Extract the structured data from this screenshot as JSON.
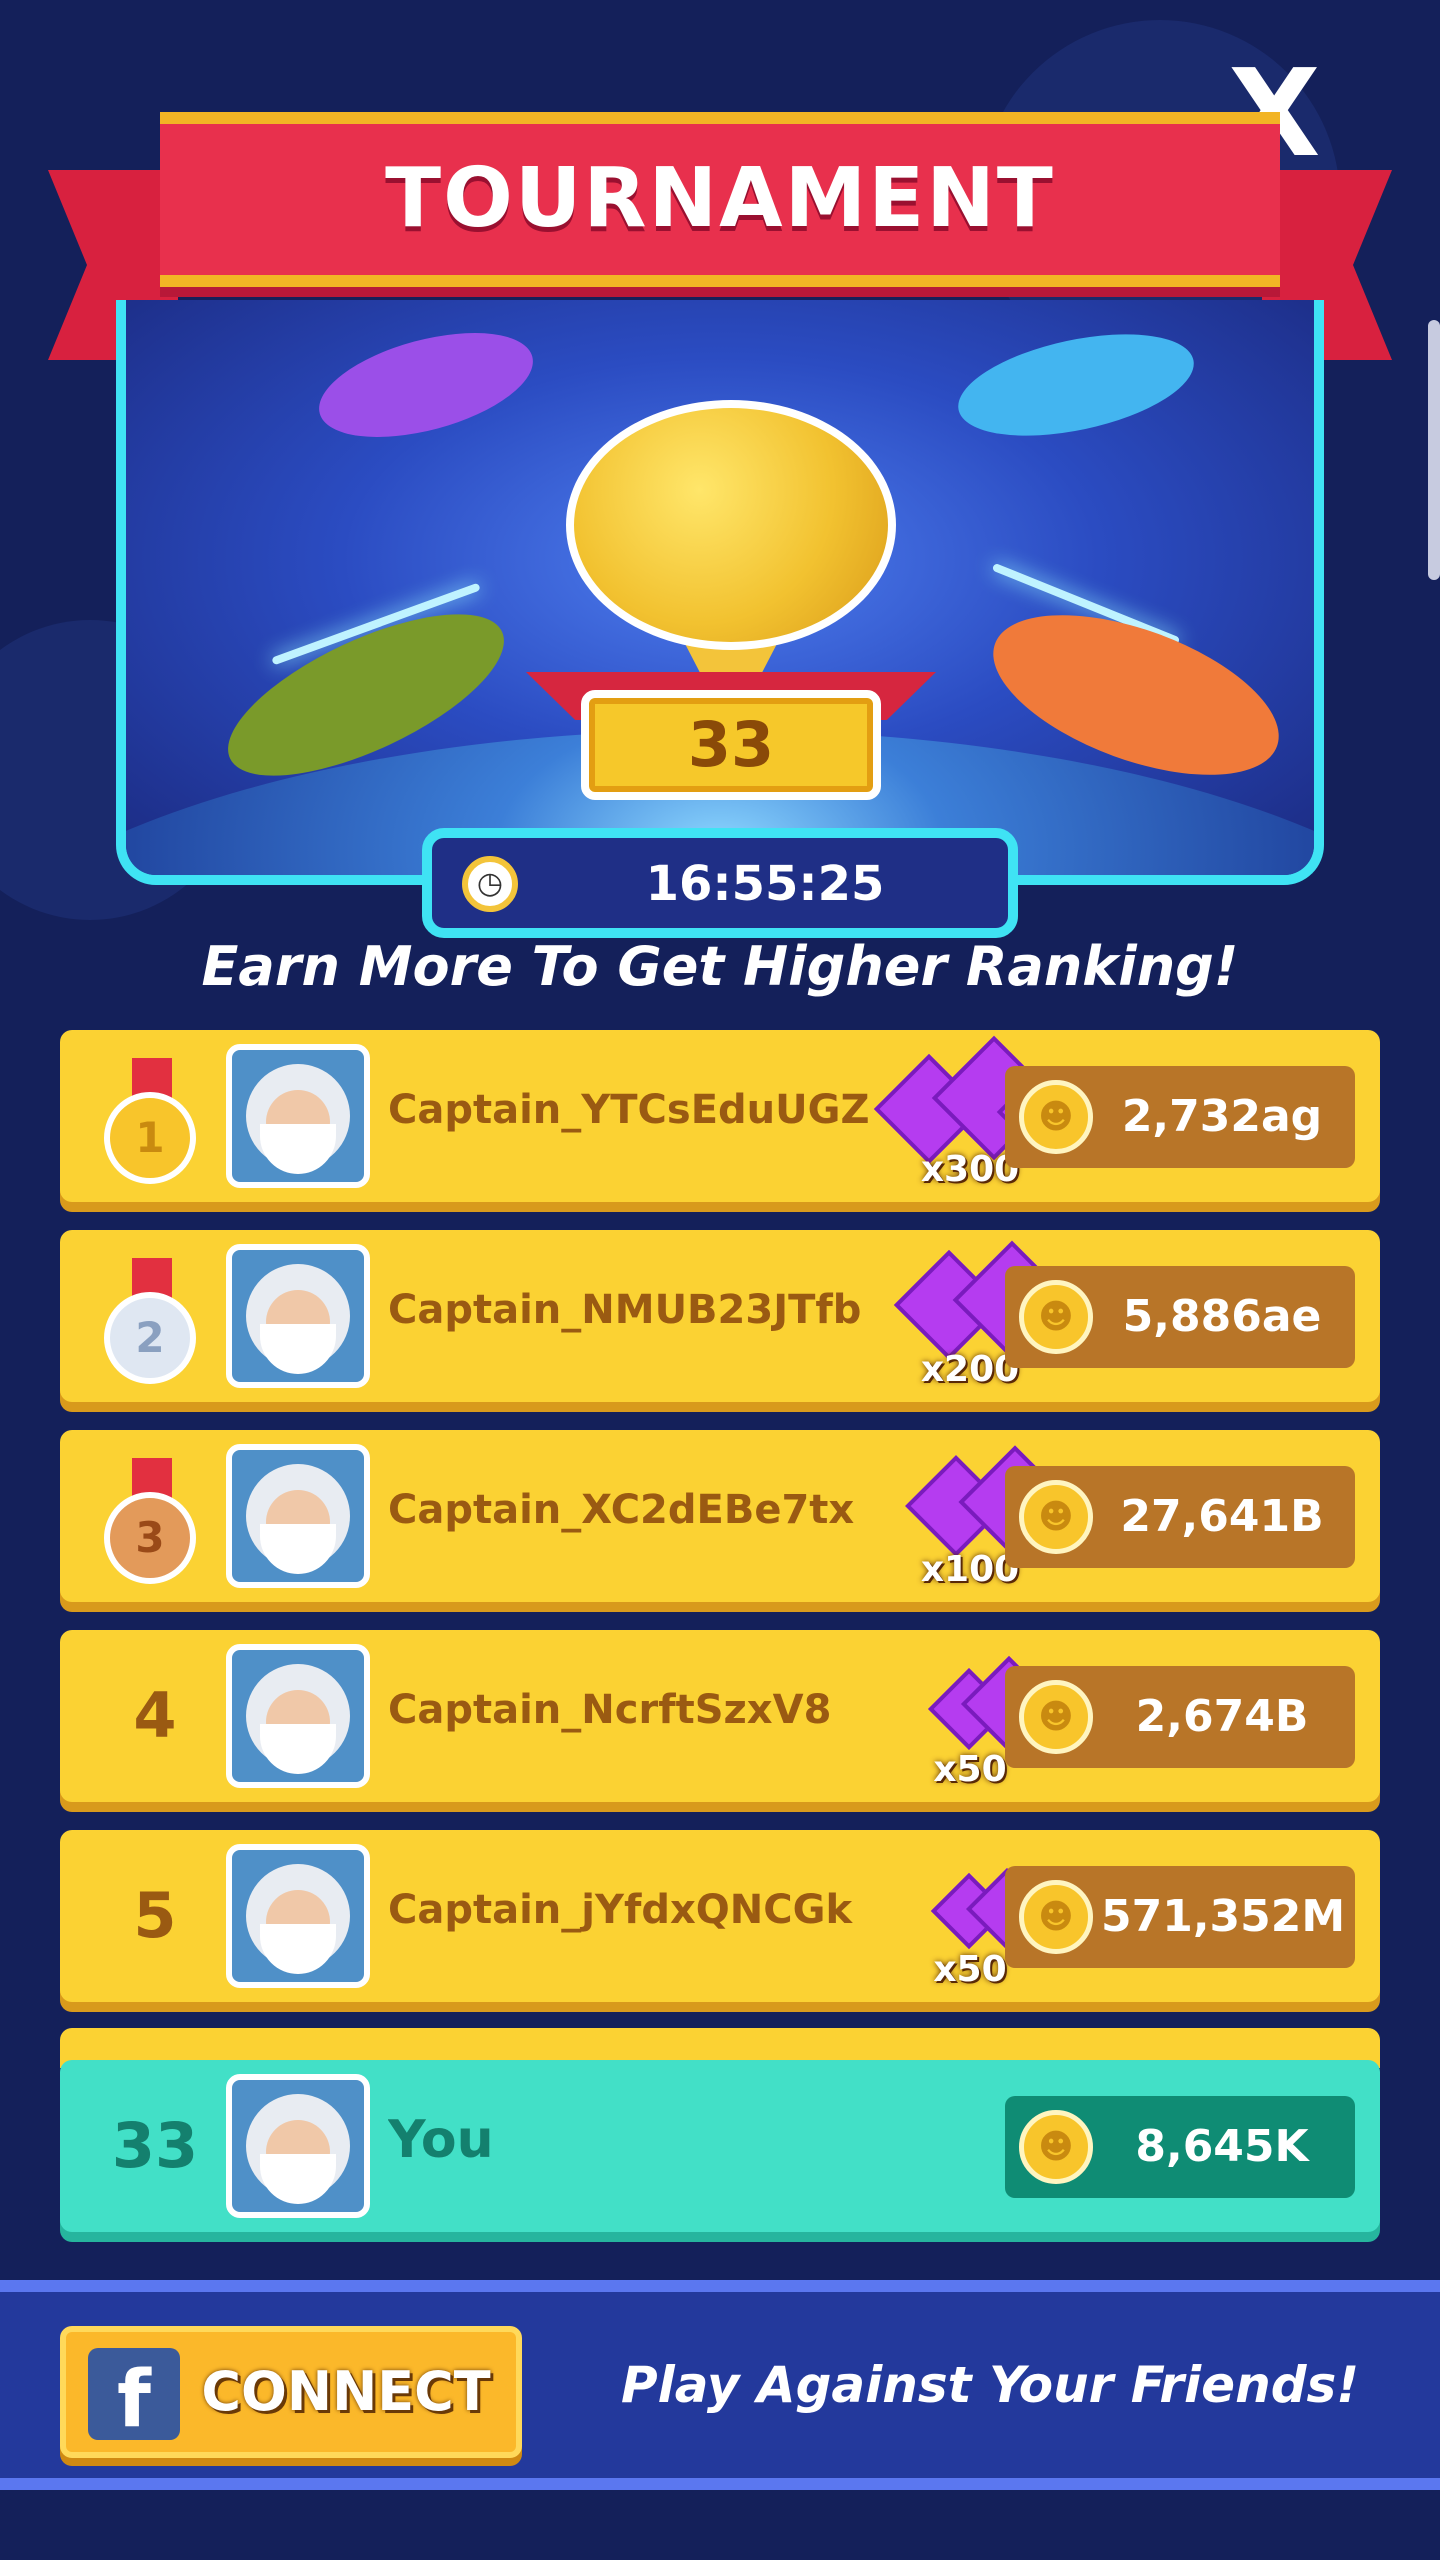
{
  "header": {
    "title": "TOURNAMENT",
    "close_label": "X"
  },
  "hero": {
    "trophy_rank": "33",
    "timer": "16:55:25",
    "timer_icon": "clock-icon"
  },
  "subtitle": "Earn More To Get Higher Ranking!",
  "leaderboard": [
    {
      "rank": "1",
      "name": "Captain_YTCsEduUGZ",
      "reward": "x300",
      "score": "2,732ag",
      "medal": "gold"
    },
    {
      "rank": "2",
      "name": "Captain_NMUB23JTfb",
      "reward": "x200",
      "score": "5,886ae",
      "medal": "silver"
    },
    {
      "rank": "3",
      "name": "Captain_XC2dEBe7tx",
      "reward": "x100",
      "score": "27,641B",
      "medal": "bronze"
    },
    {
      "rank": "4",
      "name": "Captain_NcrftSzxV8",
      "reward": "x50",
      "score": "2,674B"
    },
    {
      "rank": "5",
      "name": "Captain_jYfdxQNCGk",
      "reward": "x50",
      "score": "571,352M"
    }
  ],
  "self": {
    "rank": "33",
    "name": "You",
    "score": "8,645K"
  },
  "footer": {
    "connect_label": "CONNECT",
    "fb_glyph": "f",
    "message": "Play Against Your Friends!"
  },
  "colors": {
    "background": "#14205a",
    "ribbon": "#e8304d",
    "row": "#fbd233",
    "self_row": "#42e0c7",
    "score_box": "#b87528",
    "gem": "#b53cf0",
    "accent_cyan": "#3fe3f4"
  }
}
